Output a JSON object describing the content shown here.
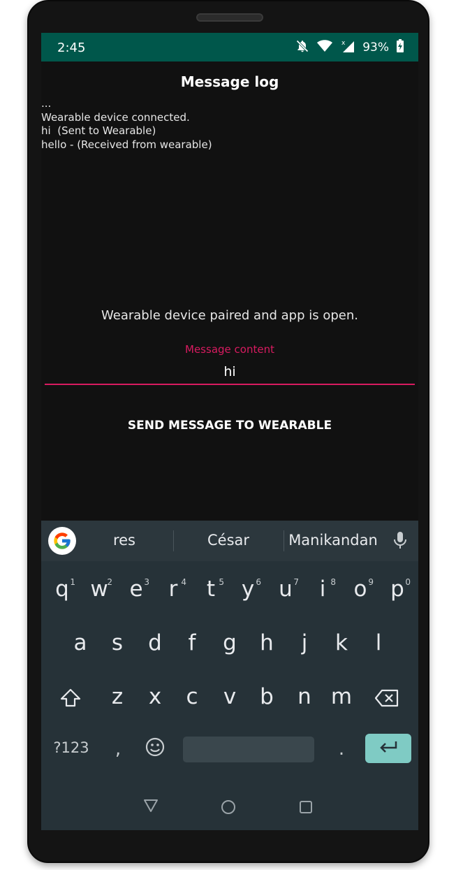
{
  "status_bar": {
    "time": "2:45",
    "battery": "93%",
    "icons": [
      "bell-off-icon",
      "wifi-icon",
      "signal-icon",
      "battery-charging-icon"
    ],
    "background_color": "#00574B"
  },
  "app": {
    "title": "Message log",
    "log_lines": [
      "...",
      "Wearable device connected.",
      "hi  (Sent to Wearable)",
      "hello - (Received from wearable)"
    ],
    "status_message": "Wearable device paired and app is open.",
    "input": {
      "label": "Message content",
      "value": "hi",
      "accent_color": "#D81B60"
    },
    "send_button_label": "SEND MESSAGE TO WEARABLE"
  },
  "keyboard": {
    "suggestions": [
      "res",
      "César",
      "Manikandan"
    ],
    "row1": [
      {
        "key": "q",
        "hint": "1"
      },
      {
        "key": "w",
        "hint": "2"
      },
      {
        "key": "e",
        "hint": "3"
      },
      {
        "key": "r",
        "hint": "4"
      },
      {
        "key": "t",
        "hint": "5"
      },
      {
        "key": "y",
        "hint": "6"
      },
      {
        "key": "u",
        "hint": "7"
      },
      {
        "key": "i",
        "hint": "8"
      },
      {
        "key": "o",
        "hint": "9"
      },
      {
        "key": "p",
        "hint": "0"
      }
    ],
    "row2": [
      "a",
      "s",
      "d",
      "f",
      "g",
      "h",
      "j",
      "k",
      "l"
    ],
    "row3": [
      "z",
      "x",
      "c",
      "v",
      "b",
      "n",
      "m"
    ],
    "symbols_label": "?123",
    "comma_label": ",",
    "period_label": ".",
    "enter_color": "#7fcbc4"
  },
  "nav_bar": {
    "icons": [
      "back-triangle-icon",
      "home-circle-icon",
      "recents-square-icon"
    ]
  }
}
